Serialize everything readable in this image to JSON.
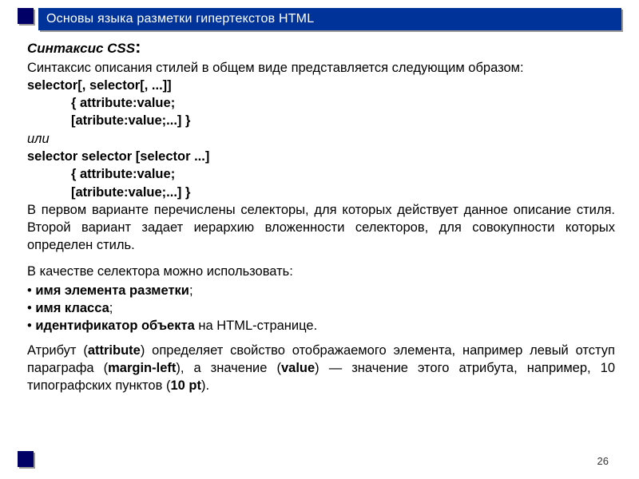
{
  "title": "Основы языка разметки гипертекстов HTML",
  "page_number": "26",
  "heading": "Синтаксис CSS",
  "intro": "Синтаксис описания стилей в общем виде представляется следующим образом:",
  "syntax1": {
    "line1": "selector[, selector[, ...]]",
    "line2": "{ attribute:value;",
    "line3": "[atribute:value;...] }"
  },
  "or_word": "или",
  "syntax2": {
    "line1": "selector selector [selector ...]",
    "line2": "{ attribute:value;",
    "line3": "[atribute:value;...] }"
  },
  "para1": "В первом варианте перечислены селекторы, для которых действует данное описание стиля. Второй вариант задает иерархию вложенности селекторов, для совокупности которых определен стиль.",
  "selector_intro": "В качестве селектора можно использовать:",
  "selector_list": {
    "item1_bold": "имя элемента разметки",
    "item2_bold": "имя класса",
    "item3_bold": "идентификатор объекта",
    "item3_tail": " на HTML-странице."
  },
  "attr_para": {
    "p1": "Атрибут (",
    "b1": "attribute",
    "p2": ") определяет свойство отображаемого элемента, например левый отступ параграфа (",
    "b2": "margin-left",
    "p3": "), а значение (",
    "b3": "value",
    "p4": ") — значение этого атрибута, например, 10 типографских пунктов (",
    "b4": "10 pt",
    "p5": ")."
  }
}
